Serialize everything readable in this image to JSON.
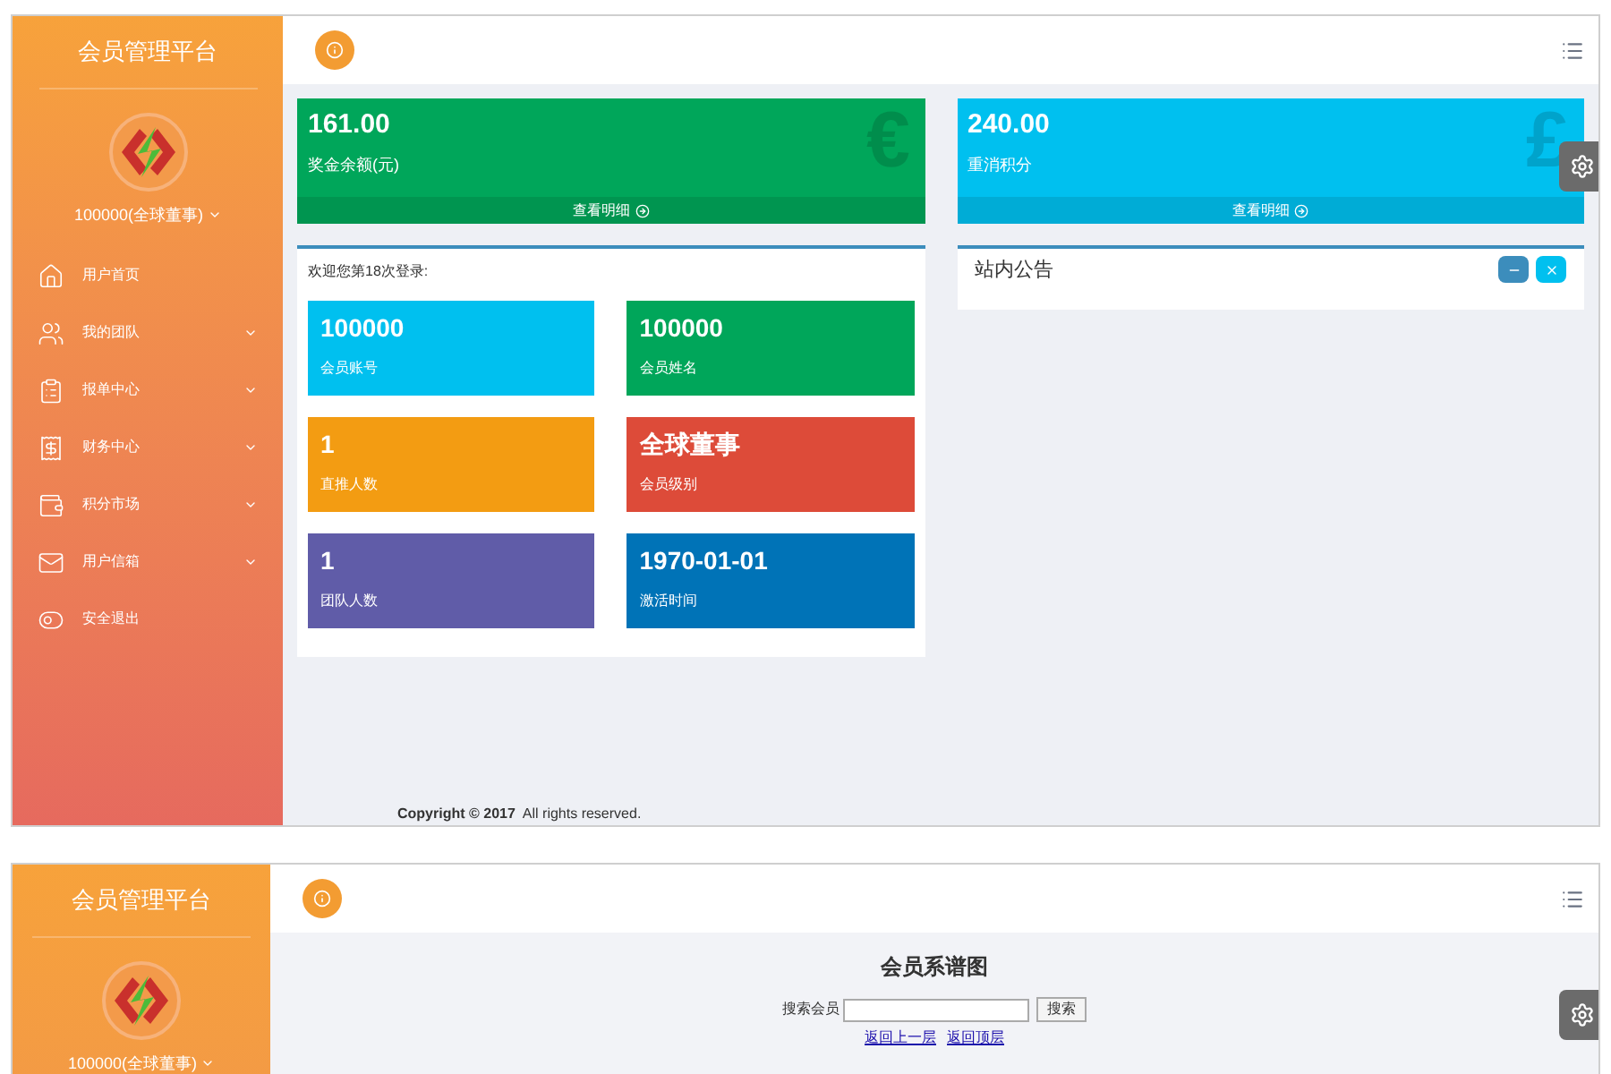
{
  "dashboard": {
    "sidebar": {
      "title": "会员管理平台",
      "user": "100000(全球董事)",
      "items": [
        {
          "label": "用户首页",
          "has_submenu": false
        },
        {
          "label": "我的团队",
          "has_submenu": true
        },
        {
          "label": "报单中心",
          "has_submenu": true
        },
        {
          "label": "财务中心",
          "has_submenu": true
        },
        {
          "label": "积分市场",
          "has_submenu": true
        },
        {
          "label": "用户信箱",
          "has_submenu": true
        },
        {
          "label": "安全退出",
          "has_submenu": false
        }
      ]
    },
    "stat_cards": [
      {
        "value": "161.00",
        "label": "奖金余额(元)",
        "link": "查看明细",
        "color": "#00a65a",
        "symbol": "€"
      },
      {
        "value": "240.00",
        "label": "重消积分",
        "link": "查看明细",
        "color": "#00c0ef",
        "symbol": "£"
      }
    ],
    "welcome": "欢迎您第18次登录:",
    "info_boxes": [
      {
        "value": "100000",
        "label": "会员账号",
        "color": "#00c0ef"
      },
      {
        "value": "100000",
        "label": "会员姓名",
        "color": "#00a65a"
      },
      {
        "value": "1",
        "label": "直推人数",
        "color": "#f39c12"
      },
      {
        "value": "全球董事",
        "label": "会员级别",
        "color": "#dd4b39"
      },
      {
        "value": "1",
        "label": "团队人数",
        "color": "#605ca8"
      },
      {
        "value": "1970-01-01",
        "label": "激活时间",
        "color": "#0073b7"
      }
    ],
    "notice": {
      "title": "站内公告"
    },
    "footer": {
      "copyright": "Copyright © 2017",
      "rights": "All rights reserved."
    }
  },
  "tree_page": {
    "sidebar": {
      "title": "会员管理平台",
      "user": "100000(全球董事)"
    },
    "title": "会员系谱图",
    "search": {
      "label": "搜索会员",
      "button": "搜索"
    },
    "links": [
      "返回上一层",
      "返回顶层"
    ]
  }
}
